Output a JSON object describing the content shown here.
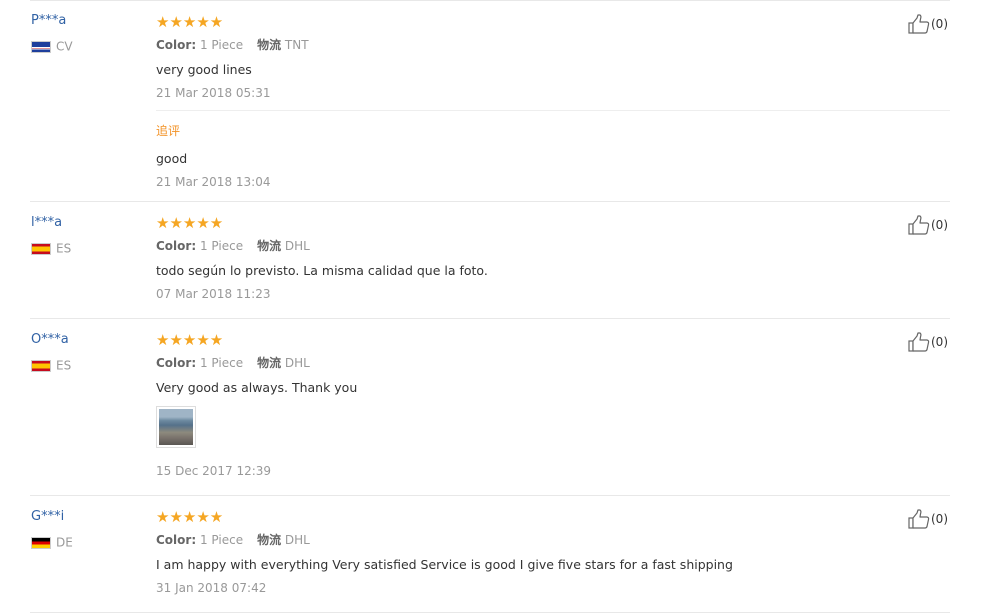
{
  "labels": {
    "color": "Color:",
    "shipping": "物流",
    "followup": "追评"
  },
  "reviews": [
    {
      "user": "P***a",
      "country": "CV",
      "stars": "★★★★★",
      "rating": 5,
      "color_value": "1 Piece",
      "shipping_value": "TNT",
      "text": "very good lines",
      "date": "21 Mar 2018 05:31",
      "followup_text": "good",
      "followup_date": "21 Mar 2018 13:04",
      "helpful": "(0)"
    },
    {
      "user": "l***a",
      "country": "ES",
      "stars": "★★★★★",
      "rating": 5,
      "color_value": "1 Piece",
      "shipping_value": "DHL",
      "text": "todo según lo previsto. La misma calidad que la foto.",
      "date": "07 Mar 2018 11:23",
      "helpful": "(0)"
    },
    {
      "user": "O***a",
      "country": "ES",
      "stars": "★★★★★",
      "rating": 5,
      "color_value": "1 Piece",
      "shipping_value": "DHL",
      "text": "Very good as always. Thank you",
      "date": "15 Dec 2017 12:39",
      "helpful": "(0)"
    },
    {
      "user": "G***i",
      "country": "DE",
      "stars": "★★★★★",
      "rating": 5,
      "color_value": "1 Piece",
      "shipping_value": "DHL",
      "text": "I am happy with everything Very satisfied Service is good I give five stars for a fast shipping",
      "date": "31 Jan 2018 07:42",
      "helpful": "(0)"
    }
  ],
  "colors": {
    "stars": "#f5a623",
    "user_link": "#3162a5",
    "followup": "#f29226"
  },
  "icons": {
    "helpful": "thumbs-up-icon",
    "flag_cv": "flag-cape-verde-icon",
    "flag_es": "flag-spain-icon",
    "flag_de": "flag-germany-icon"
  }
}
